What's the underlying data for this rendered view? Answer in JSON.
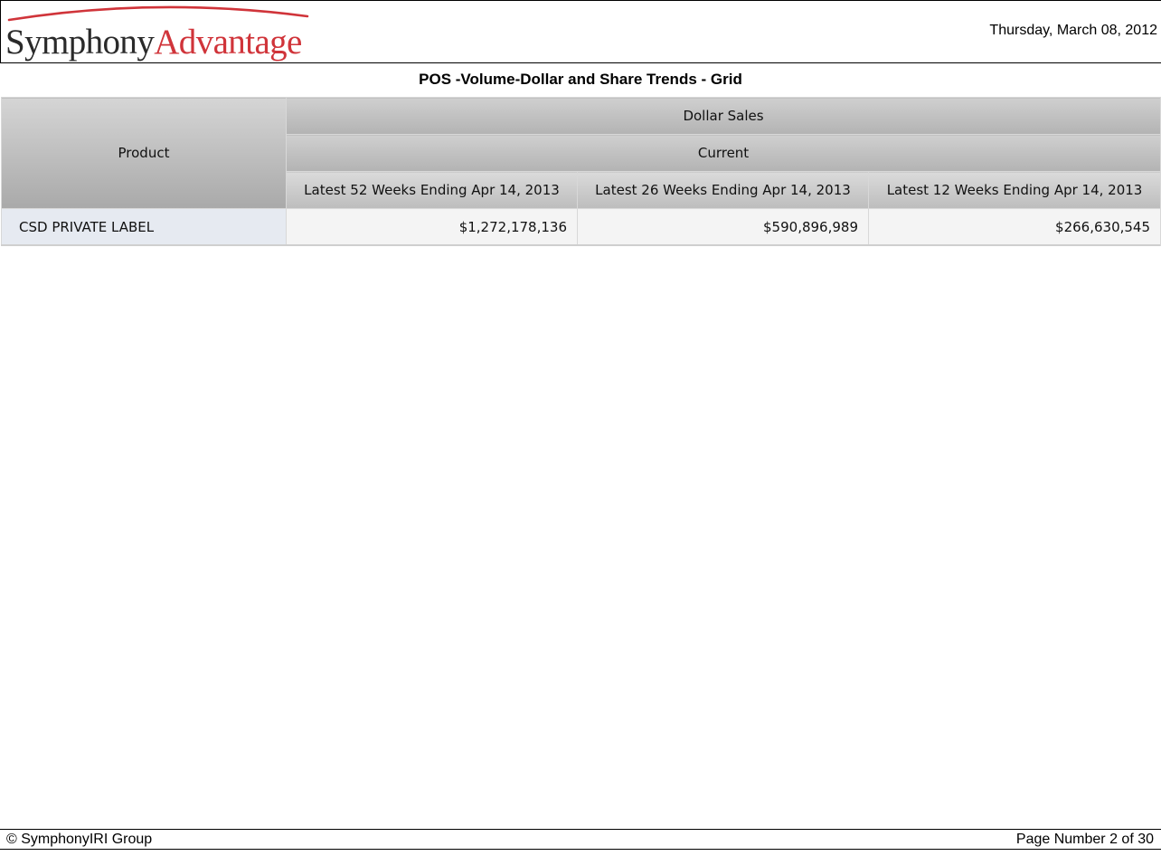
{
  "brand": {
    "logo_part_1": "Symphony",
    "logo_part_2": "Advantage",
    "accent_color": "#d0343a"
  },
  "header": {
    "date": "Thursday, March 08, 2012"
  },
  "report": {
    "title": "POS -Volume-Dollar and Share Trends - Grid"
  },
  "grid": {
    "product_header": "Product",
    "measure_header": "Dollar Sales",
    "period_group_header": "Current",
    "period_headers": [
      "Latest 52 Weeks Ending Apr 14, 2013",
      "Latest 26 Weeks Ending Apr 14, 2013",
      "Latest 12 Weeks Ending Apr 14, 2013"
    ],
    "rows": [
      {
        "product": "CSD PRIVATE LABEL",
        "values": [
          "$1,272,178,136",
          "$590,896,989",
          "$266,630,545"
        ]
      }
    ]
  },
  "footer": {
    "copyright": "© SymphonyIRI Group",
    "page_number": "Page Number 2 of 30"
  }
}
